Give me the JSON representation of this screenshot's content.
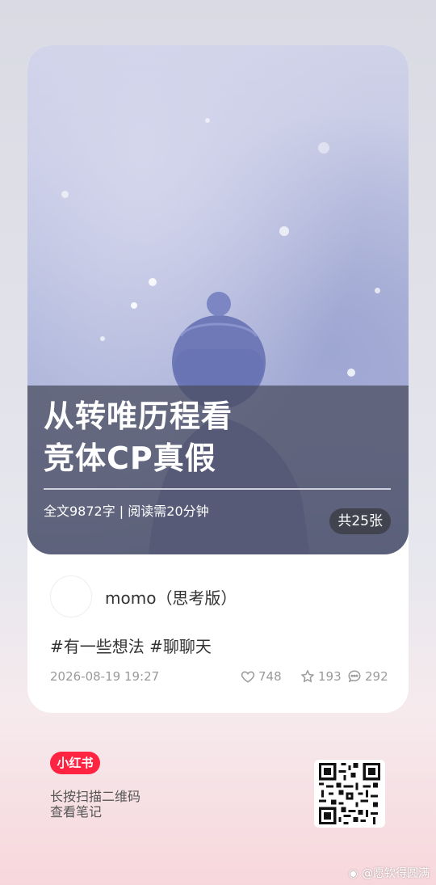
{
  "card": {
    "cover": {
      "title_line1": "从转唯历程看",
      "title_line2": "竞体CP真假",
      "meta": "全文9872字 | 阅读需20分钟",
      "image_count": "共25张"
    },
    "author": {
      "name": "momo（思考版）"
    },
    "tags": "#有一些想法 #聊聊天",
    "date": "2026-08-19 19:27",
    "likes": "748",
    "favorites": "193",
    "comments": "292"
  },
  "footer": {
    "badge": "小红书",
    "line1": "长按扫描二维码",
    "line2": "查看笔记"
  },
  "watermark": "@愿钦得圆满",
  "colors": {
    "brand": "#ff2442",
    "stat_gray": "#9a9a9a"
  },
  "icons": [
    "heart-icon",
    "star-icon",
    "comment-icon",
    "qr-code",
    "weibo-icon"
  ]
}
